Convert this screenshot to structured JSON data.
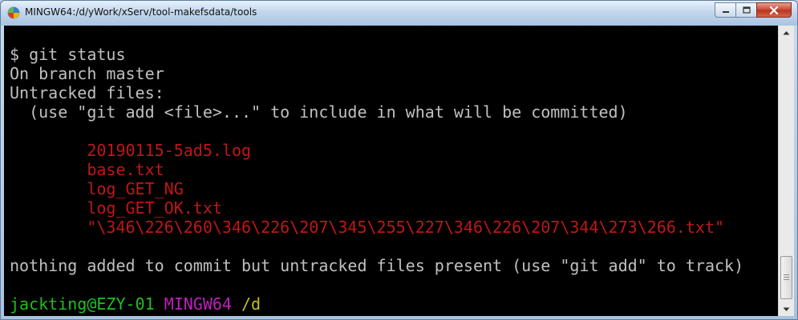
{
  "window": {
    "title": "MINGW64:/d/yWork/xServ/tool-makefsdata/tools",
    "icons": {
      "app": "mingw-app-icon",
      "minimize": "minimize-icon",
      "maximize": "maximize-icon",
      "close": "close-icon"
    }
  },
  "terminal": {
    "lines": {
      "cmd": "$ git status",
      "branch": "On branch master",
      "untracked_header": "Untracked files:",
      "hint": "  (use \"git add <file>...\" to include in what will be committed)",
      "blank1": "",
      "file1": "        20190115-5ad5.log",
      "file2": "        base.txt",
      "file3": "        log_GET_NG",
      "file4": "        log_GET_OK.txt",
      "file5": "        \"\\346\\226\\260\\346\\226\\207\\345\\255\\227\\346\\226\\207\\344\\273\\266.txt\"",
      "blank2": "",
      "summary": "nothing added to commit but untracked files present (use \"git add\" to track)",
      "blank3": ""
    },
    "prompt": {
      "user_host": "jackting@EZY-01",
      "env": "MINGW64",
      "path": "/d",
      "symbol": "$"
    },
    "colors": {
      "default": "#c0c0c0",
      "untracked": "#bf1717",
      "user_host": "#1fbf1f",
      "env": "#bf1fbf",
      "path": "#bfbf1f",
      "background": "#000000"
    }
  },
  "scrollbar": {
    "up": "scroll-up-arrow-icon",
    "down": "scroll-down-arrow-icon"
  }
}
